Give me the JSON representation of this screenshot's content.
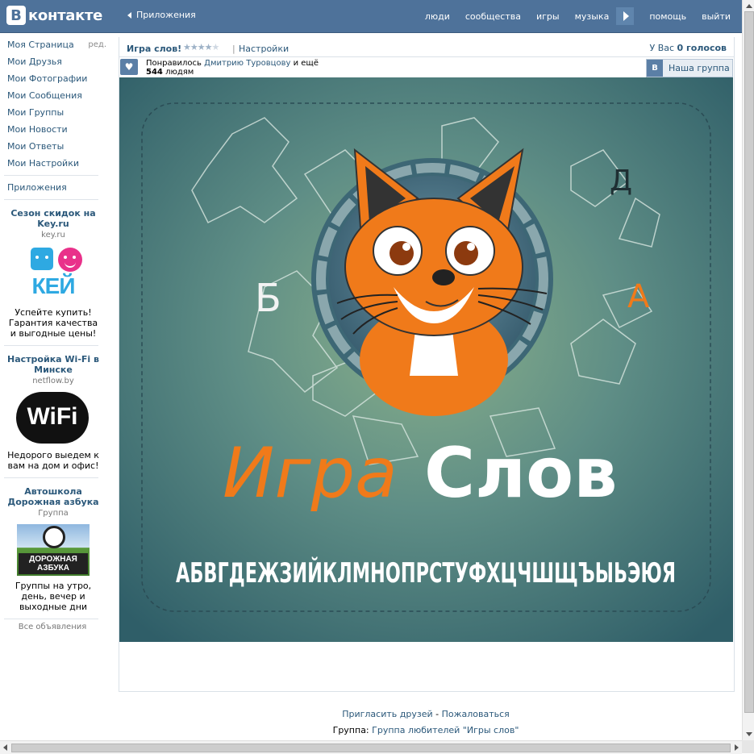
{
  "header": {
    "logo_letter": "B",
    "logo_text": "контакте",
    "back_label": "Приложения",
    "nav": [
      "люди",
      "сообщества",
      "игры",
      "музыка",
      "помощь",
      "выйти"
    ]
  },
  "sidebar": {
    "items": [
      {
        "label": "Моя Страница",
        "edit": "ред."
      },
      {
        "label": "Мои Друзья"
      },
      {
        "label": "Мои Фотографии"
      },
      {
        "label": "Мои Сообщения"
      },
      {
        "label": "Мои Группы"
      },
      {
        "label": "Мои Новости"
      },
      {
        "label": "Мои Ответы"
      },
      {
        "label": "Мои Настройки"
      }
    ],
    "apps_label": "Приложения",
    "ads": [
      {
        "title": "Сезон скидок на Key.ru",
        "domain": "key.ru",
        "text": "Успейте купить! Гарантия качества и выгодные цены!",
        "logo": "КЕЙ"
      },
      {
        "title": "Настройка Wi-Fi в Минске",
        "domain": "netflow.by",
        "text": "Недорого выедем к вам на дом и офис!",
        "logo": "WiFi"
      },
      {
        "title": "Автошкола Дорожная азбука",
        "domain": "Группа",
        "text": "Группы на утро, день, вечер и выходные дни",
        "logo": "ДОРОЖНАЯ АЗБУКА"
      }
    ],
    "all_ads": "Все объявления"
  },
  "app": {
    "title": "Игра слов!",
    "rating_stars": 4,
    "settings_label": "Настройки",
    "votes_prefix": "У Вас",
    "votes_value": "0 голосов",
    "likes_prefix": "Понравилось",
    "likes_friend": "Дмитрию Туровцову",
    "likes_and": "и ещё",
    "likes_count": "544",
    "likes_suffix": "людям",
    "group_button_letter": "В",
    "group_button": "Наша группа",
    "game_title_1": "Игра",
    "game_title_2": "Слов",
    "alphabet": "АБВГДЕЖЗИЙКЛМНОПРСТУФХЦЧШЩЪЫЬЭЮЯ",
    "floating_letters": [
      "Б",
      "Д",
      "А"
    ]
  },
  "footer": {
    "invite": "Пригласить друзей",
    "sep": " - ",
    "complain": "Пожаловаться",
    "group_prefix": "Группа:",
    "group_link": "Группа любителей \"Игры слов\""
  },
  "colors": {
    "header": "#4e729a",
    "link": "#2b587a",
    "game_bg": "#4f7f7d",
    "fox": "#f07a1a"
  }
}
